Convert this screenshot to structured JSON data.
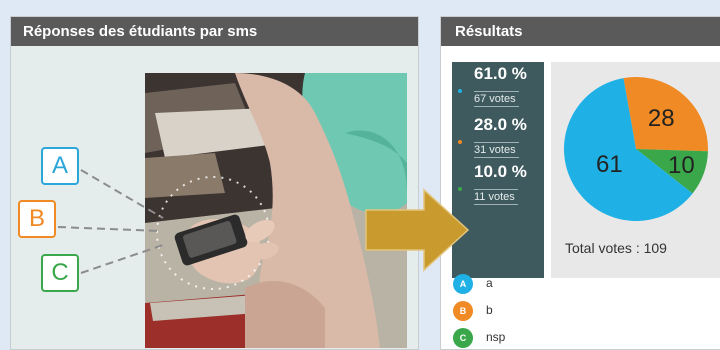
{
  "left_panel": {
    "title": "Réponses des étudiants par sms",
    "options": [
      {
        "letter": "A",
        "color": "#2aa6d8"
      },
      {
        "letter": "B",
        "color": "#f08a24"
      },
      {
        "letter": "C",
        "color": "#3aa84a"
      }
    ]
  },
  "right_panel": {
    "title": "Résultats",
    "stats": [
      {
        "percent": "61.0 %",
        "votes": "67 votes",
        "color": "#1fb0e6"
      },
      {
        "percent": "28.0 %",
        "votes": "31 votes",
        "color": "#f08a24"
      },
      {
        "percent": "10.0 %",
        "votes": "11 votes",
        "color": "#3aa84a"
      }
    ],
    "total_votes": "Total votes : 109",
    "legend": [
      {
        "letter": "A",
        "label": "a",
        "color": "#1fb0e6"
      },
      {
        "letter": "B",
        "label": "b",
        "color": "#f08a24"
      },
      {
        "letter": "C",
        "label": "nsp",
        "color": "#3aa84a"
      }
    ]
  },
  "chart_data": {
    "type": "pie",
    "categories": [
      "a",
      "b",
      "nsp"
    ],
    "values": [
      61,
      28,
      10
    ],
    "colors": [
      "#1fb0e6",
      "#f08a24",
      "#3aa84a"
    ],
    "data_labels": [
      "61",
      "28",
      "10"
    ],
    "total_label": "Total votes : 109"
  },
  "colors": {
    "header_bg": "#5a5a5a",
    "stats_bg": "#3e5a5e",
    "arrow": "#c99a2e"
  }
}
